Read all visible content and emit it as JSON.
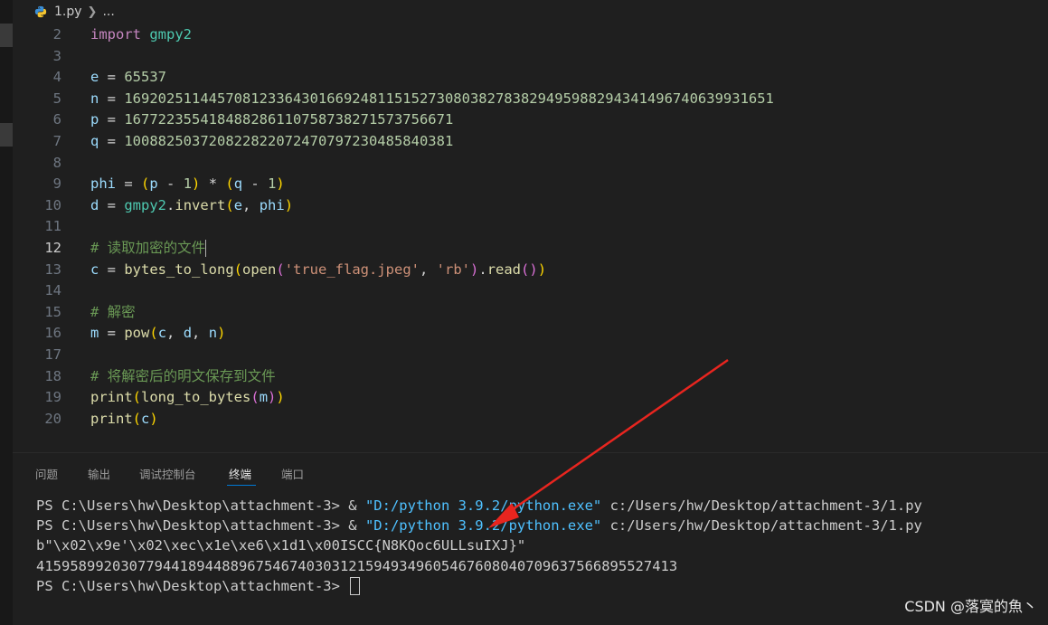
{
  "breadcrumb": {
    "file": "1.py",
    "more": "..."
  },
  "editor": {
    "lines": [
      {
        "n": "2",
        "tokens": [
          [
            "kw",
            "import"
          ],
          [
            "op",
            " "
          ],
          [
            "mod",
            "gmpy2"
          ]
        ]
      },
      {
        "n": "3",
        "tokens": []
      },
      {
        "n": "4",
        "tokens": [
          [
            "var",
            "e"
          ],
          [
            "op",
            " = "
          ],
          [
            "num",
            "65537"
          ]
        ]
      },
      {
        "n": "5",
        "tokens": [
          [
            "var",
            "n"
          ],
          [
            "op",
            " = "
          ],
          [
            "num",
            "16920251144570812336430166924811515273080382783829495988294341496740639931651"
          ]
        ]
      },
      {
        "n": "6",
        "tokens": [
          [
            "var",
            "p"
          ],
          [
            "op",
            " = "
          ],
          [
            "num",
            "167722355418488286110758738271573756671"
          ]
        ]
      },
      {
        "n": "7",
        "tokens": [
          [
            "var",
            "q"
          ],
          [
            "op",
            " = "
          ],
          [
            "num",
            "100882503720822822072470797230485840381"
          ]
        ]
      },
      {
        "n": "8",
        "tokens": []
      },
      {
        "n": "9",
        "tokens": [
          [
            "var",
            "phi"
          ],
          [
            "op",
            " = "
          ],
          [
            "p1",
            "("
          ],
          [
            "var",
            "p"
          ],
          [
            "op",
            " - "
          ],
          [
            "num",
            "1"
          ],
          [
            "p1",
            ")"
          ],
          [
            "op",
            " * "
          ],
          [
            "p1",
            "("
          ],
          [
            "var",
            "q"
          ],
          [
            "op",
            " - "
          ],
          [
            "num",
            "1"
          ],
          [
            "p1",
            ")"
          ]
        ]
      },
      {
        "n": "10",
        "tokens": [
          [
            "var",
            "d"
          ],
          [
            "op",
            " = "
          ],
          [
            "mod",
            "gmpy2"
          ],
          [
            "op",
            "."
          ],
          [
            "fn",
            "invert"
          ],
          [
            "p1",
            "("
          ],
          [
            "var",
            "e"
          ],
          [
            "op",
            ", "
          ],
          [
            "var",
            "phi"
          ],
          [
            "p1",
            ")"
          ]
        ]
      },
      {
        "n": "11",
        "tokens": []
      },
      {
        "n": "12",
        "tokens": [
          [
            "cm",
            "# 读取加密的文件"
          ]
        ],
        "active": true,
        "caret": true
      },
      {
        "n": "13",
        "tokens": [
          [
            "var",
            "c"
          ],
          [
            "op",
            " = "
          ],
          [
            "fn",
            "bytes_to_long"
          ],
          [
            "p1",
            "("
          ],
          [
            "fn",
            "open"
          ],
          [
            "p2",
            "("
          ],
          [
            "str",
            "'true_flag.jpeg'"
          ],
          [
            "op",
            ", "
          ],
          [
            "str",
            "'rb'"
          ],
          [
            "p2",
            ")"
          ],
          [
            "op",
            "."
          ],
          [
            "fn",
            "read"
          ],
          [
            "p2",
            "()"
          ],
          [
            "p1",
            ")"
          ]
        ]
      },
      {
        "n": "14",
        "tokens": []
      },
      {
        "n": "15",
        "tokens": [
          [
            "cm",
            "# 解密"
          ]
        ]
      },
      {
        "n": "16",
        "tokens": [
          [
            "var",
            "m"
          ],
          [
            "op",
            " = "
          ],
          [
            "fn",
            "pow"
          ],
          [
            "p1",
            "("
          ],
          [
            "var",
            "c"
          ],
          [
            "op",
            ", "
          ],
          [
            "var",
            "d"
          ],
          [
            "op",
            ", "
          ],
          [
            "var",
            "n"
          ],
          [
            "p1",
            ")"
          ]
        ]
      },
      {
        "n": "17",
        "tokens": []
      },
      {
        "n": "18",
        "tokens": [
          [
            "cm",
            "# 将解密后的明文保存到文件"
          ]
        ]
      },
      {
        "n": "19",
        "tokens": [
          [
            "fn",
            "print"
          ],
          [
            "p1",
            "("
          ],
          [
            "fn",
            "long_to_bytes"
          ],
          [
            "p2",
            "("
          ],
          [
            "var",
            "m"
          ],
          [
            "p2",
            ")"
          ],
          [
            "p1",
            ")"
          ]
        ]
      },
      {
        "n": "20",
        "tokens": [
          [
            "fn",
            "print"
          ],
          [
            "p1",
            "("
          ],
          [
            "var",
            "c"
          ],
          [
            "p1",
            ")"
          ]
        ]
      }
    ]
  },
  "panel": {
    "tabs": [
      "问题",
      "输出",
      "调试控制台",
      "终端",
      "端口"
    ],
    "active_tab": "终端"
  },
  "terminal": {
    "prompt": "PS C:\\Users\\hw\\Desktop\\attachment-3> ",
    "amp": "& ",
    "exe": "\"D:/python 3.9.2/python.exe\"",
    "script": " c:/Users/hw/Desktop/attachment-3/1.py",
    "output1": "b\"\\x02\\x9e'\\x02\\xec\\x1e\\xe6\\x1d1\\x00ISCC{N8KQoc6ULLsuIXJ}\"",
    "output2": "415958992030779441894488967546740303121594934960546760804070963756689552741​3"
  },
  "watermark": "CSDN @落寞的魚丶",
  "colors": {
    "arrow": "#e8251f",
    "background": "#1f1f1f",
    "accent": "#0078d4"
  }
}
